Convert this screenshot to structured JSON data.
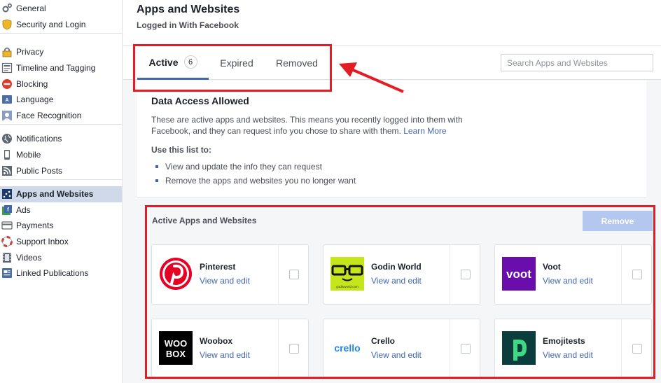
{
  "sidebar": {
    "groups": [
      {
        "items": [
          {
            "label": "General",
            "icon": "gear-icon"
          },
          {
            "label": "Security and Login",
            "icon": "shield-icon"
          }
        ]
      },
      {
        "items": [
          {
            "label": "Privacy",
            "icon": "lock-icon"
          },
          {
            "label": "Timeline and Tagging",
            "icon": "timeline-icon"
          },
          {
            "label": "Blocking",
            "icon": "block-icon"
          },
          {
            "label": "Language",
            "icon": "language-icon"
          },
          {
            "label": "Face Recognition",
            "icon": "face-icon"
          }
        ]
      },
      {
        "items": [
          {
            "label": "Notifications",
            "icon": "globe-icon"
          },
          {
            "label": "Mobile",
            "icon": "mobile-icon"
          },
          {
            "label": "Public Posts",
            "icon": "rss-icon"
          }
        ]
      },
      {
        "items": [
          {
            "label": "Apps and Websites",
            "icon": "apps-icon",
            "selected": true
          },
          {
            "label": "Ads",
            "icon": "ads-icon"
          },
          {
            "label": "Payments",
            "icon": "card-icon"
          },
          {
            "label": "Support Inbox",
            "icon": "lifebuoy-icon"
          },
          {
            "label": "Videos",
            "icon": "film-icon"
          },
          {
            "label": "Linked Publications",
            "icon": "publications-icon"
          }
        ]
      }
    ]
  },
  "header": {
    "title": "Apps and Websites",
    "subtitle": "Logged in With Facebook"
  },
  "tabs": [
    {
      "label": "Active",
      "count": "6",
      "active": true
    },
    {
      "label": "Expired"
    },
    {
      "label": "Removed"
    }
  ],
  "search": {
    "placeholder": "Search Apps and Websites"
  },
  "info": {
    "heading": "Data Access Allowed",
    "description": "These are active apps and websites. This means you recently logged into them with Facebook, and they can request info you chose to share with them.",
    "learn_more": "Learn More",
    "use_heading": "Use this list to:",
    "bullets": [
      "View and update the info they can request",
      "Remove the apps and websites you no longer want"
    ]
  },
  "apps_section": {
    "title": "Active Apps and Websites",
    "remove_label": "Remove",
    "apps": [
      {
        "name": "Pinterest",
        "link": "View and edit",
        "logo": "pinterest-logo",
        "color": "#e60023"
      },
      {
        "name": "Godin World",
        "link": "View and edit",
        "logo": "godin-world-logo",
        "color": "#c5e61a",
        "logo_text": "godinworld.com"
      },
      {
        "name": "Voot",
        "link": "View and edit",
        "logo": "voot-logo",
        "color": "#6a0dad",
        "logo_text": "voot"
      },
      {
        "name": "Woobox",
        "link": "View and edit",
        "logo": "woobox-logo",
        "color": "#000000",
        "logo_text": "WOO BOX"
      },
      {
        "name": "Crello",
        "link": "View and edit",
        "logo": "crello-logo",
        "color": "#1e88e5",
        "logo_text": "crello"
      },
      {
        "name": "Emojitests",
        "link": "View and edit",
        "logo": "emojitests-logo",
        "color": "#0b3d3d",
        "logo_text": "D"
      }
    ]
  },
  "colors": {
    "accent": "#4267b2",
    "annotation": "#e21e24",
    "selected_nav": "#cfd9ea"
  }
}
